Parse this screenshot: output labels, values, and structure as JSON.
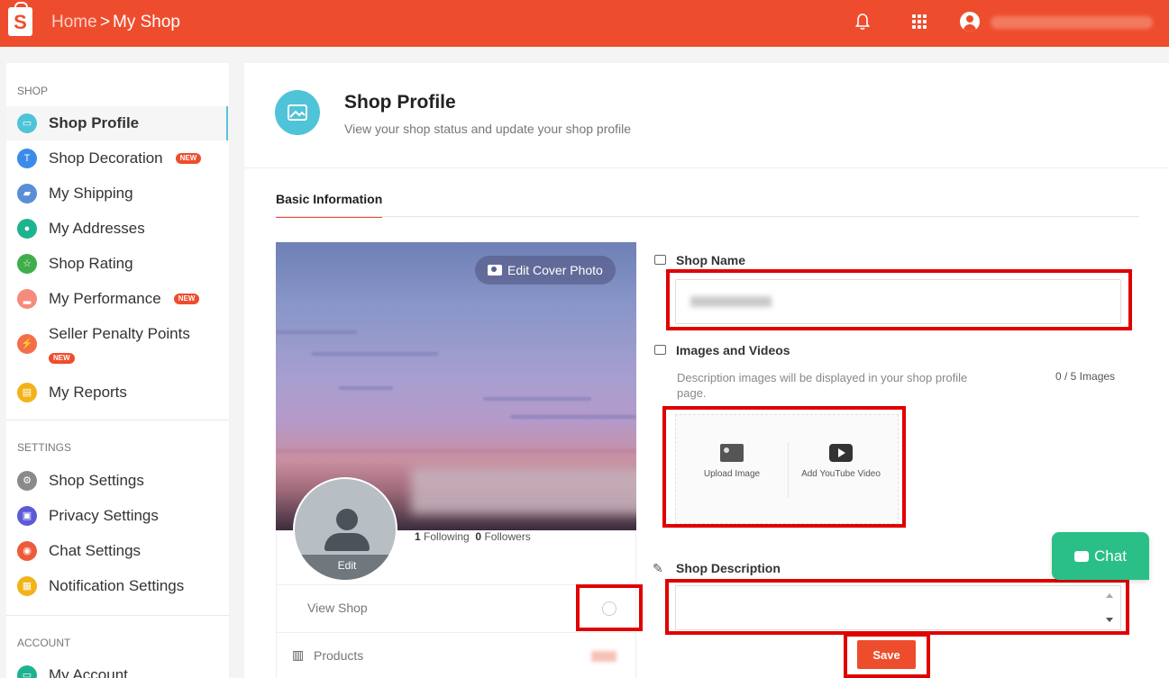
{
  "topbar": {
    "breadcrumb_home": "Home",
    "breadcrumb_sep": ">",
    "breadcrumb_current": "My Shop",
    "logo_letter": "S",
    "brand_color": "#ee4d2d"
  },
  "sidebar": {
    "shop_section": "SHOP",
    "settings_section": "SETTINGS",
    "account_section": "ACCOUNT",
    "badge_new": "NEW",
    "shop_items": [
      {
        "label": "Shop Profile",
        "icon": "shop-profile-icon",
        "color": "#4fc3d7"
      },
      {
        "label": "Shop Decoration",
        "icon": "brush-icon",
        "color": "#3b8be8"
      },
      {
        "label": "My Shipping",
        "icon": "truck-icon",
        "color": "#5b8ed8"
      },
      {
        "label": "My Addresses",
        "icon": "location-icon",
        "color": "#1db38f"
      },
      {
        "label": "Shop Rating",
        "icon": "star-icon",
        "color": "#3fae4a"
      },
      {
        "label": "My Performance",
        "icon": "chart-icon",
        "color": "#f58b7a"
      },
      {
        "label": "Seller Penalty Points",
        "icon": "penalty-icon",
        "color": "#f56e4a"
      },
      {
        "label": "My Reports",
        "icon": "report-icon",
        "color": "#f2b318"
      }
    ],
    "settings_items": [
      {
        "label": "Shop Settings",
        "icon": "gear-icon",
        "color": "#8a8a8a"
      },
      {
        "label": "Privacy Settings",
        "icon": "lock-icon",
        "color": "#5b5bd6"
      },
      {
        "label": "Chat Settings",
        "icon": "chat-settings-icon",
        "color": "#ef5a3a"
      },
      {
        "label": "Notification Settings",
        "icon": "notification-icon",
        "color": "#f2b318"
      }
    ],
    "account_items": [
      {
        "label": "My Account",
        "icon": "account-icon",
        "color": "#1db38f"
      }
    ]
  },
  "main": {
    "title": "Shop Profile",
    "subtitle": "View your shop status and update your shop profile",
    "tab_basic": "Basic Information",
    "edit_cover_photo": "Edit Cover Photo",
    "avatar_edit": "Edit",
    "following_count": "1",
    "following_label": "Following",
    "followers_count": "0",
    "followers_label": "Followers",
    "view_shop": "View Shop",
    "products": "Products",
    "shop_name_label": "Shop Name",
    "images_label": "Images and Videos",
    "images_desc": "Description images will be displayed in your shop profile page.",
    "images_count": "0 / 5 Images",
    "upload_image": "Upload Image",
    "add_youtube": "Add YouTube Video",
    "description_label": "Shop Description",
    "save": "Save",
    "chat": "Chat"
  }
}
